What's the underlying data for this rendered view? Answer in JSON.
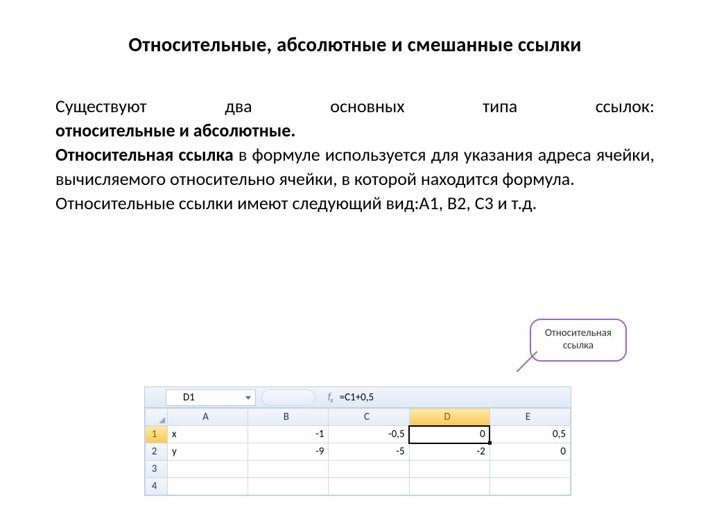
{
  "title": "Относительные, абсолютные и  смешанные ссылки",
  "paragraph": {
    "line1_a": "Существуют",
    "line1_b": "два",
    "line1_c": "основных",
    "line1_d": "типа",
    "line1_e": "ссылок:",
    "bold1": "относительные и абсолютные.",
    "bold2": "Относительная ссылка",
    "rest1": " в формуле используется для указания адреса ячейки, вычисляемого относительно ячейки, в которой находится формула.",
    "rest2": "Относительные ссылки имеют следующий вид:А1, В2, С3 и т.д."
  },
  "callout": {
    "l1": "Относительная",
    "l2": "ссылка"
  },
  "excel": {
    "name_box": "D1",
    "fx_label": "fx",
    "formula": "=C1+0,5",
    "columns": [
      "A",
      "B",
      "C",
      "D",
      "E"
    ],
    "rows": [
      {
        "num": "1",
        "cells": [
          "x",
          "-1",
          "-0,5",
          "0",
          "0,5"
        ]
      },
      {
        "num": "2",
        "cells": [
          "y",
          "-9",
          "-5",
          "-2",
          "0"
        ]
      },
      {
        "num": "3",
        "cells": [
          "",
          "",
          "",
          "",
          ""
        ]
      },
      {
        "num": "4",
        "cells": [
          "",
          "",
          "",
          "",
          ""
        ]
      }
    ],
    "active_col_index": 3,
    "active_row_index": 0
  }
}
